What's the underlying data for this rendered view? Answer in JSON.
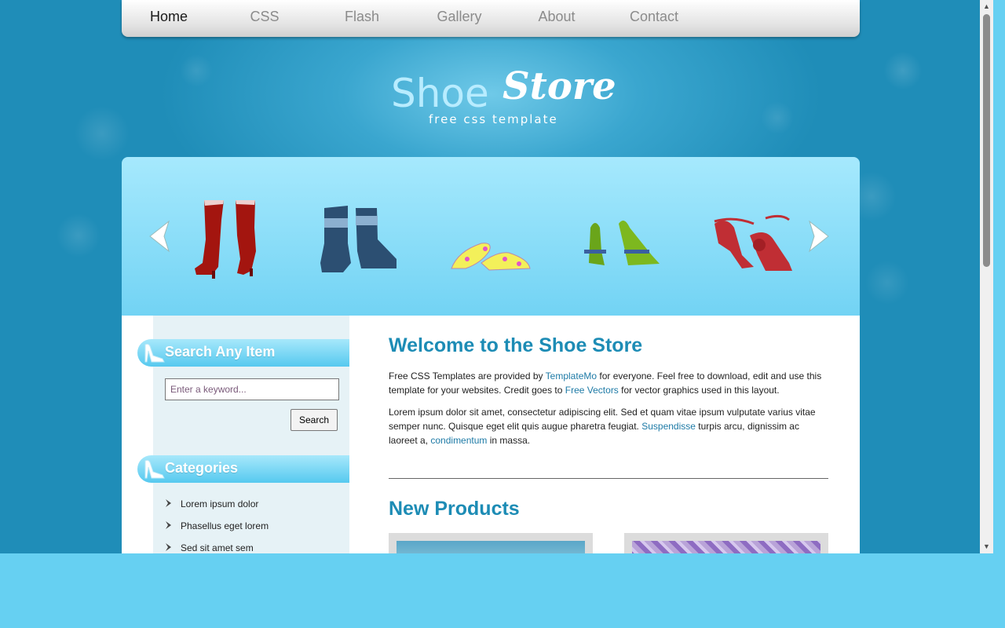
{
  "nav": {
    "items": [
      {
        "label": "Home",
        "active": true
      },
      {
        "label": "CSS",
        "active": false
      },
      {
        "label": "Flash",
        "active": false
      },
      {
        "label": "Gallery",
        "active": false
      },
      {
        "label": "About",
        "active": false
      },
      {
        "label": "Contact",
        "active": false
      }
    ]
  },
  "logo": {
    "word1": "Shoe",
    "word2": "Store",
    "tagline": "free css template"
  },
  "slider": {
    "shoes": [
      "red-boots-icon",
      "blue-boots-icon",
      "yellow-flats-icon",
      "green-sandals-icon",
      "red-heels-icon"
    ]
  },
  "sidebar": {
    "search_heading": "Search Any Item",
    "search_placeholder": "Enter a keyword...",
    "search_button": "Search",
    "categories_heading": "Categories",
    "categories": [
      "Lorem ipsum dolor",
      "Phasellus eget lorem",
      "Sed sit amet sem"
    ]
  },
  "main": {
    "welcome_title": "Welcome to the Shoe Store",
    "p1": {
      "t1": "Free CSS Templates are provided by ",
      "link1": "TemplateMo",
      "t2": " for everyone. Feel free to download, edit and use this template for your websites. Credit goes to ",
      "link2": "Free Vectors",
      "t3": " for vector graphics used in this layout."
    },
    "p2": {
      "t1": "Lorem ipsum dolor sit amet, consectetur adipiscing elit. Sed et quam vitae ipsum vulputate varius vitae semper nunc. Quisque eget elit quis augue pharetra feugiat. ",
      "link1": "Suspendisse",
      "t2": " turpis arcu, dignissim ac laoreet a, ",
      "link2": "condimentum",
      "t3": " in massa."
    },
    "products_title": "New Products"
  },
  "colors": {
    "background": "#66d0f2",
    "heading": "#1d8cb5",
    "link": "#1d7aa6"
  }
}
